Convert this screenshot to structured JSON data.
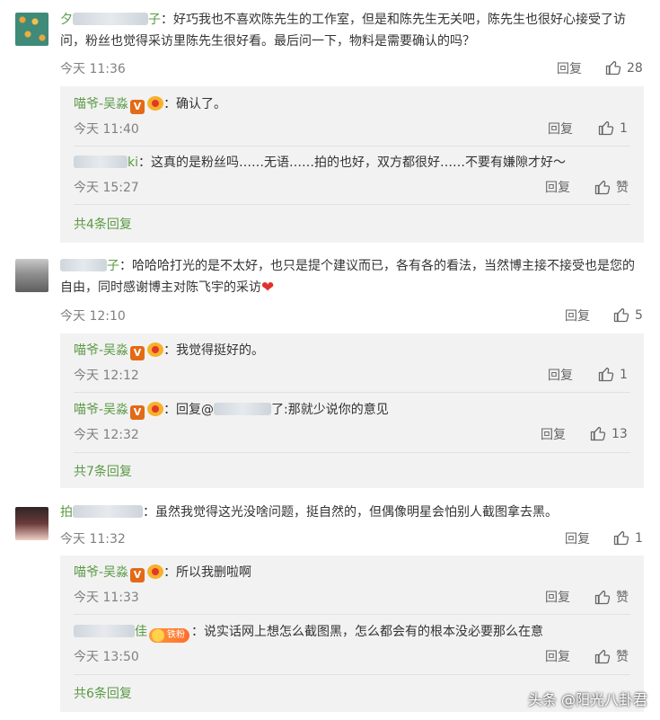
{
  "watermark": "头条 @阳光八卦君",
  "comments": [
    {
      "user": "夕",
      "user_tail": "子",
      "text": "：好巧我也不喜欢陈先生的工作室，但是和陈先生无关吧，陈先生也很好心接受了访问，粉丝也觉得采访里陈先生很好看。最后问一下，物料是需要确认的吗？",
      "time": "今天 11:36",
      "reply_label": "回复",
      "likes": "28",
      "replies": [
        {
          "author": "喵爷-吴淼",
          "text": "：确认了。",
          "time": "今天 11:40",
          "reply_label": "回复",
          "likes": "1"
        },
        {
          "author_tail": "ki",
          "text": "：这真的是粉丝吗……无语……拍的也好，双方都很好……不要有嫌隙才好～",
          "time": "今天 15:27",
          "reply_label": "回复",
          "likes": "赞"
        }
      ],
      "more": "共4条回复"
    },
    {
      "user_tail": "子",
      "text": "：哈哈哈打光的是不太好，也只是提个建议而已，各有各的看法，当然博主接不接受也是您的自由，同时感谢博主对陈飞宇的采访",
      "time": "今天 12:10",
      "reply_label": "回复",
      "likes": "5",
      "replies": [
        {
          "author": "喵爷-吴淼",
          "text": "：我觉得挺好的。",
          "time": "今天 12:12",
          "reply_label": "回复",
          "likes": "1"
        },
        {
          "author": "喵爷-吴淼",
          "text_pre": "：回复@",
          "text": "了:那就少说你的意见",
          "time": "今天 12:32",
          "reply_label": "回复",
          "likes": "13"
        }
      ],
      "more": "共7条回复"
    },
    {
      "user": "拍",
      "text": "：虽然我觉得这光没啥问题，挺自然的，但偶像明星会怕别人截图拿去黑。",
      "time": "今天 11:32",
      "reply_label": "回复",
      "likes": "1",
      "replies": [
        {
          "author": "喵爷-吴淼",
          "text": "：所以我删啦啊",
          "time": "今天 11:33",
          "reply_label": "回复",
          "likes": "赞"
        },
        {
          "author_tail": "佳",
          "badge": "铁粉",
          "text": "：说实话网上想怎么截图黑，怎么都会有的根本没必要那么在意",
          "time": "今天 13:50",
          "reply_label": "回复",
          "likes": "赞"
        }
      ],
      "more": "共6条回复"
    }
  ]
}
